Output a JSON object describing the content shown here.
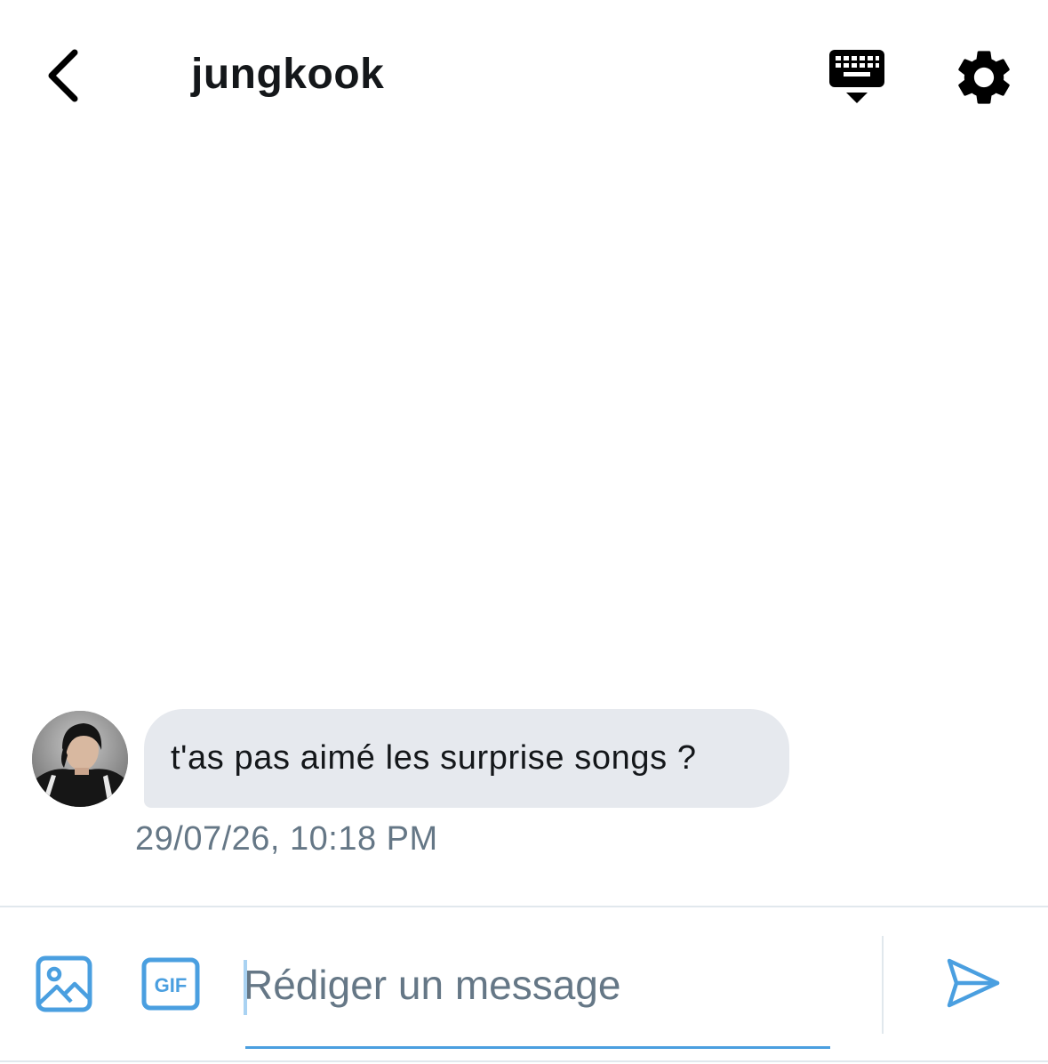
{
  "header": {
    "title": "jungkook",
    "back_icon": "chevron-left-icon",
    "keyboard_icon": "keyboard-hide-icon",
    "settings_icon": "gear-icon"
  },
  "conversation": {
    "messages": [
      {
        "sender": "jungkook",
        "avatar_icon": "avatar",
        "text": "t'as pas aimé les surprise songs ?",
        "timestamp": "29/07/26, 10:18 PM"
      }
    ]
  },
  "composer": {
    "media_icon": "image-icon",
    "gif_label": "GIF",
    "placeholder": "Rédiger un message",
    "value": "",
    "send_icon": "send-icon"
  },
  "colors": {
    "accent": "#1da1f2",
    "bubble_bg": "#e6e9ee",
    "secondary_text": "#657786",
    "primary_text": "#14171a"
  }
}
